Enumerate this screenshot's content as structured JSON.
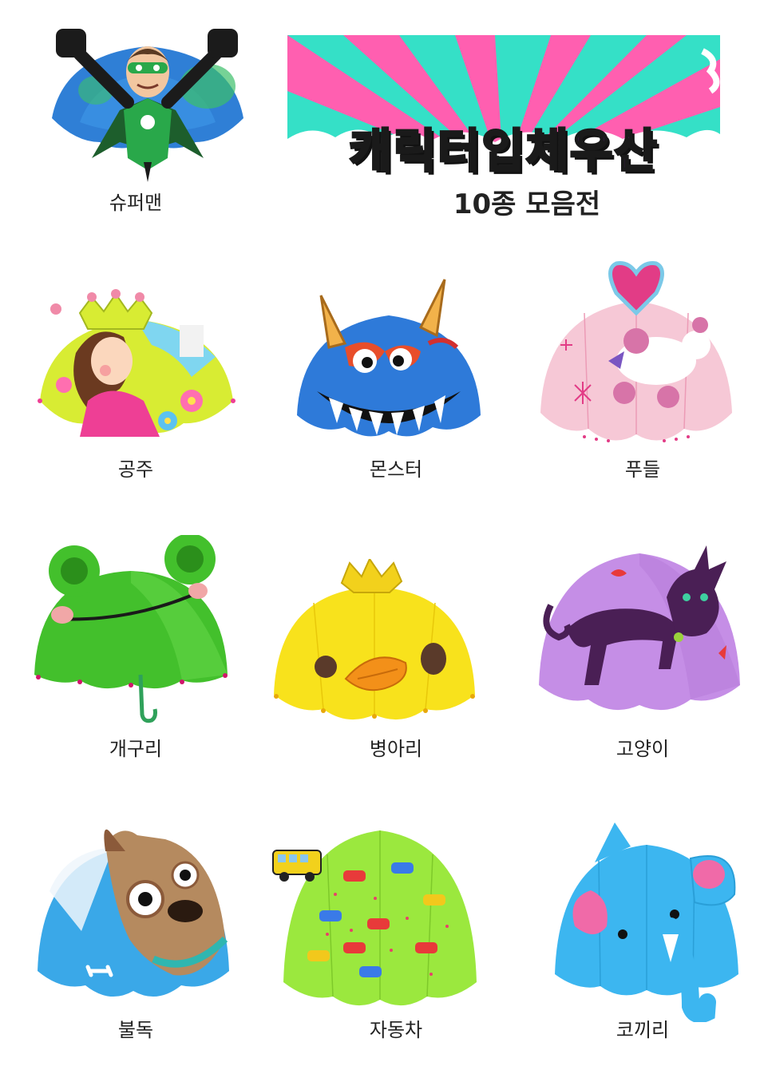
{
  "banner": {
    "title": "캐릭터입체우산",
    "subtitle": "10종 모음전",
    "colors": {
      "pink": "#ff3fa6",
      "teal": "#35e0c7",
      "purple": "#a020f0",
      "yellow": "#f4d400",
      "green": "#1ec83a"
    }
  },
  "umbrellas": [
    {
      "name": "슈퍼맨",
      "icon": "superhero-umbrella-image",
      "color": "#2f7fd6"
    },
    {
      "name": "공주",
      "icon": "princess-umbrella-image",
      "color": "#d8ec33"
    },
    {
      "name": "몬스터",
      "icon": "monster-umbrella-image",
      "color": "#2e7ad9"
    },
    {
      "name": "푸들",
      "icon": "poodle-umbrella-image",
      "color": "#f6c8d6"
    },
    {
      "name": "개구리",
      "icon": "frog-umbrella-image",
      "color": "#43c02c"
    },
    {
      "name": "병아리",
      "icon": "chick-umbrella-image",
      "color": "#f8e21c"
    },
    {
      "name": "고양이",
      "icon": "cat-umbrella-image",
      "color": "#c58ee6"
    },
    {
      "name": "불독",
      "icon": "bulldog-umbrella-image",
      "color": "#3aa8e8"
    },
    {
      "name": "자동차",
      "icon": "car-umbrella-image",
      "color": "#9be83e"
    },
    {
      "name": "코끼리",
      "icon": "elephant-umbrella-image",
      "color": "#3cb6f0"
    }
  ]
}
